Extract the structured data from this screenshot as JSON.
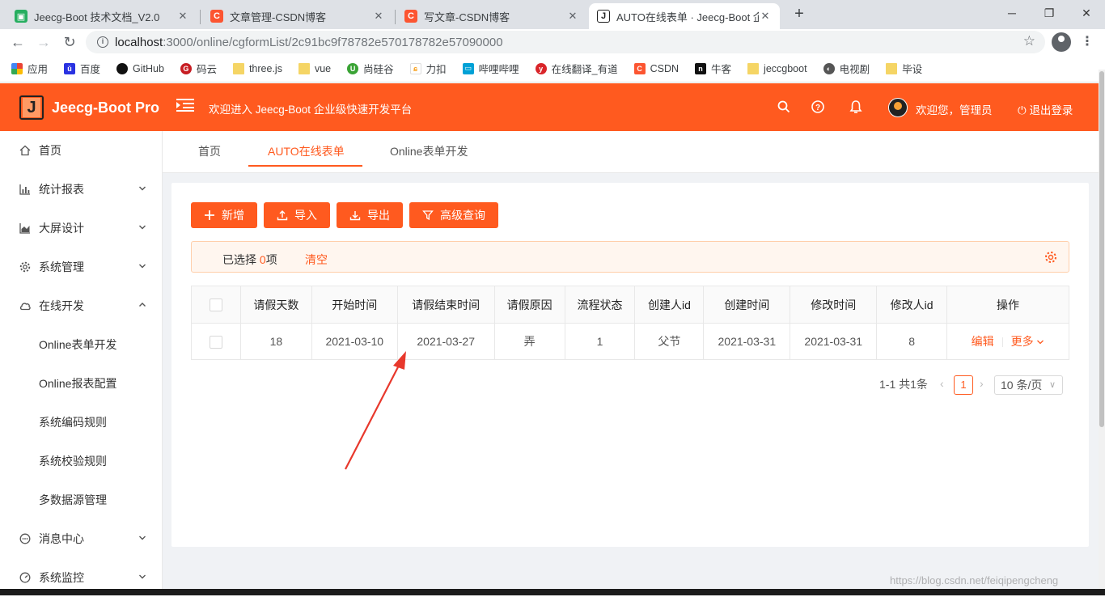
{
  "browser": {
    "tabs": [
      {
        "title": "Jeecg-Boot 技术文档_V2.0",
        "favicon": "green-doc-icon",
        "color": "#27ae60"
      },
      {
        "title": "文章管理-CSDN博客",
        "favicon": "csdn-icon",
        "color": "#fc5531"
      },
      {
        "title": "写文章-CSDN博客",
        "favicon": "csdn-icon",
        "color": "#fc5531"
      },
      {
        "title": "AUTO在线表单 · Jeecg-Boot 企",
        "favicon": "jeecg-icon",
        "color": "#222222"
      }
    ],
    "url_host": "localhost",
    "url_path": ":3000/online/cgformList/2c91bc9f78782e570178782e57090000",
    "bookmarks": [
      "应用",
      "百度",
      "GitHub",
      "码云",
      "three.js",
      "vue",
      "尚硅谷",
      "力扣",
      "哔哩哔哩",
      "在线翻译_有道",
      "CSDN",
      "牛客",
      "jeccgboot",
      "电视剧",
      "毕设"
    ]
  },
  "header": {
    "app_title": "Jeecg-Boot Pro",
    "welcome": "欢迎进入 Jeecg-Boot 企业级快速开发平台",
    "user": "欢迎您，管理员",
    "logout": "退出登录",
    "brand_color": "#ff5a1f"
  },
  "sidebar": {
    "items": [
      {
        "label": "首页",
        "icon": "home-icon"
      },
      {
        "label": "统计报表",
        "icon": "bar-chart-icon"
      },
      {
        "label": "大屏设计",
        "icon": "area-chart-icon"
      },
      {
        "label": "系统管理",
        "icon": "gear-icon"
      },
      {
        "label": "在线开发",
        "icon": "cloud-icon"
      },
      {
        "label": "消息中心",
        "icon": "message-icon"
      },
      {
        "label": "系统监控",
        "icon": "dashboard-icon"
      }
    ],
    "sub_items": [
      "Online表单开发",
      "Online报表配置",
      "系统编码规则",
      "系统校验规则",
      "多数据源管理"
    ]
  },
  "page_tabs": [
    "首页",
    "AUTO在线表单",
    "Online表单开发"
  ],
  "toolbar": {
    "add": "新增",
    "import": "导入",
    "export": "导出",
    "advanced_query": "高级查询"
  },
  "selection": {
    "prefix": "已选择 ",
    "count": "0",
    "suffix": "项",
    "clear": "清空"
  },
  "table": {
    "columns": [
      "请假天数",
      "开始时间",
      "请假结束时间",
      "请假原因",
      "流程状态",
      "创建人id",
      "创建时间",
      "修改时间",
      "修改人id",
      "操作"
    ],
    "rows": [
      {
        "days": "18",
        "start": "2021-03-10",
        "end": "2021-03-27",
        "reason": "弄",
        "status": "1",
        "creator": "父节",
        "created": "2021-03-31",
        "modified": "2021-03-31",
        "modifier": "8",
        "edit": "编辑",
        "more": "更多"
      }
    ]
  },
  "pagination": {
    "summary": "1-1 共1条",
    "current": "1",
    "page_size": "10 条/页"
  },
  "watermark": "https://blog.csdn.net/feiqipengcheng"
}
